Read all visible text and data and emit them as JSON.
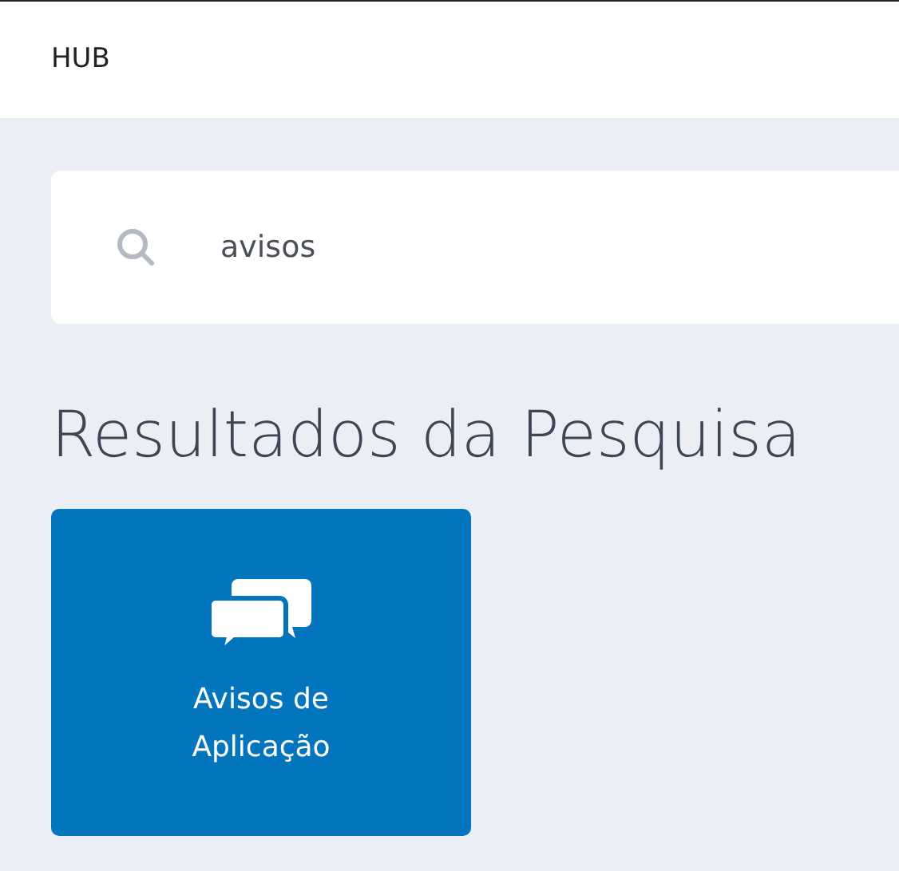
{
  "header": {
    "title": "HUB"
  },
  "search": {
    "value": "avisos"
  },
  "results": {
    "heading": "Resultados da Pesquisa",
    "tiles": [
      {
        "label": "Avisos de Aplicação",
        "kind": "chat"
      }
    ]
  }
}
